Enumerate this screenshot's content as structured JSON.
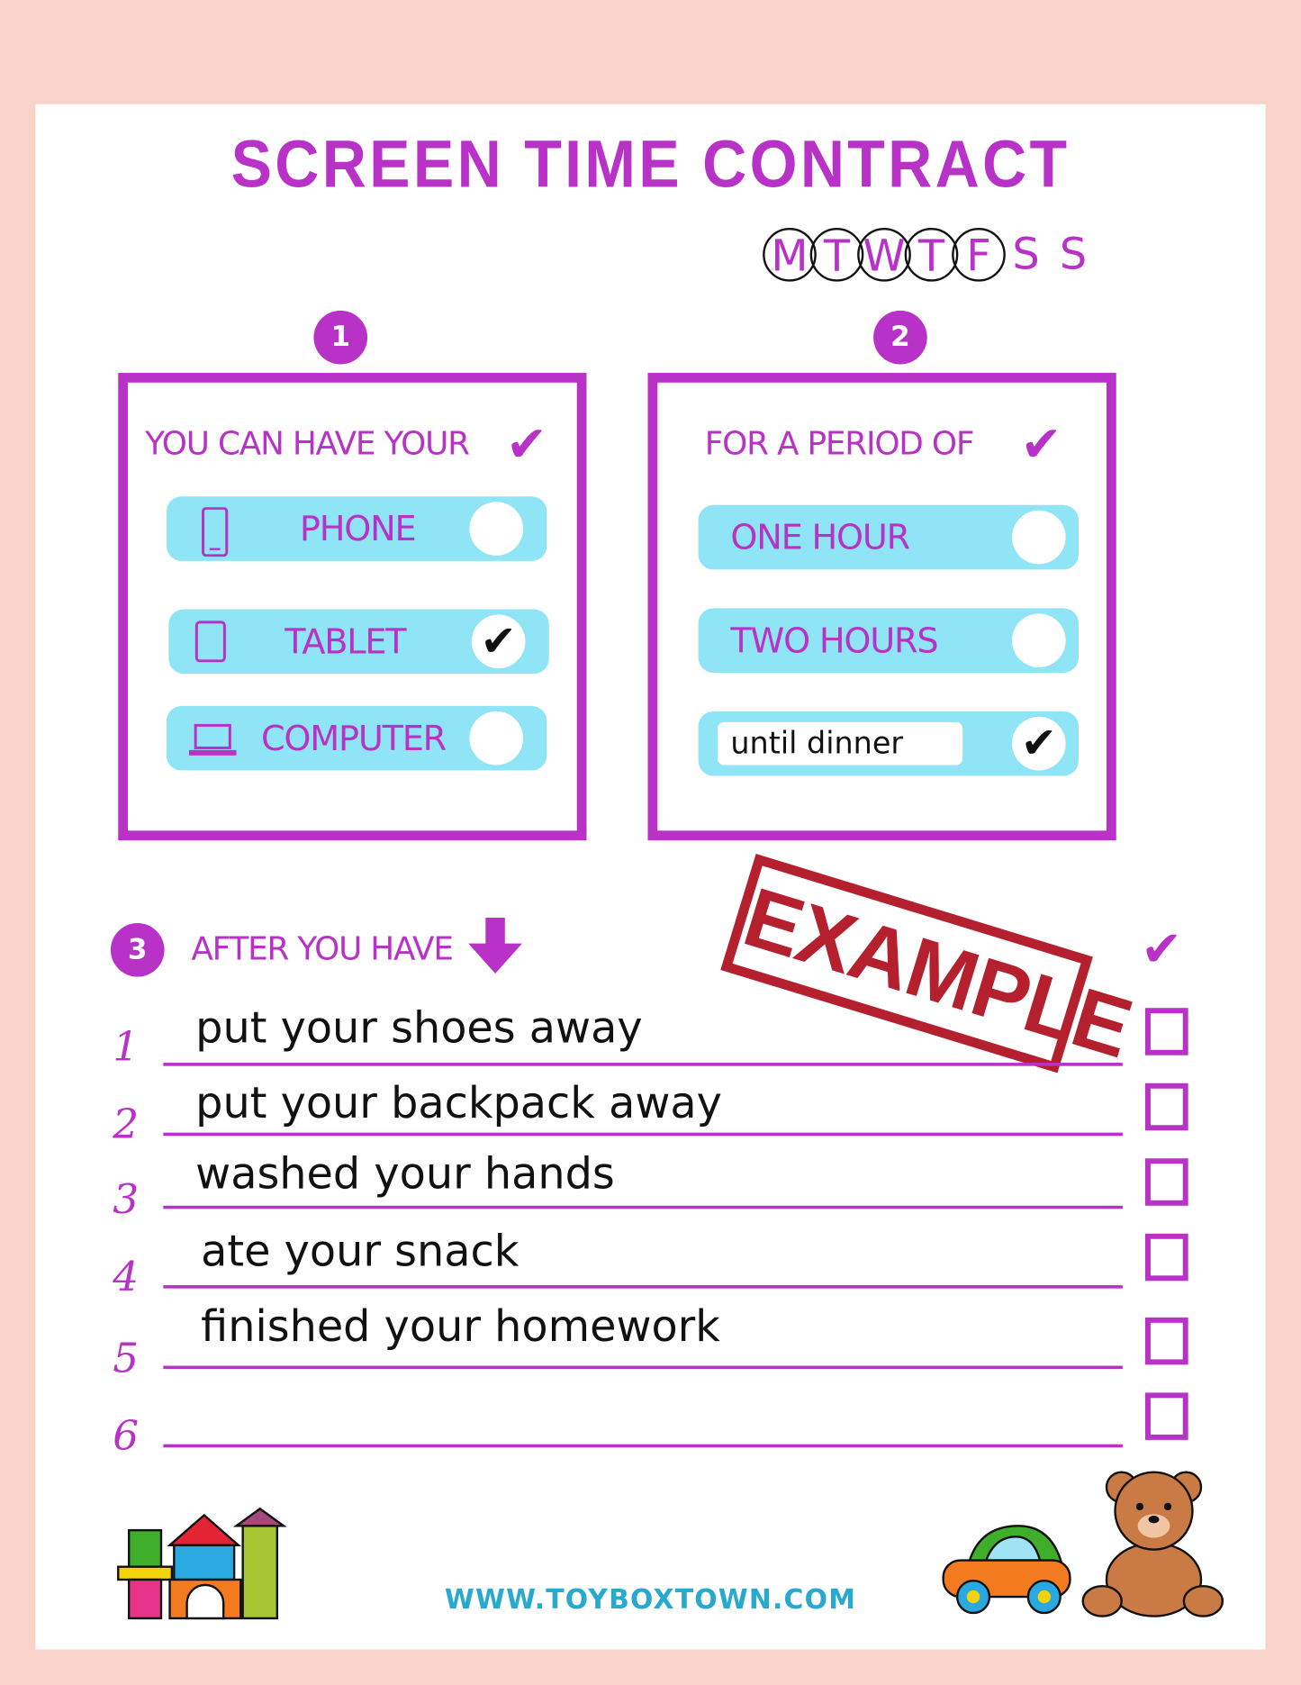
{
  "title": "SCREEN TIME CONTRACT",
  "days": [
    {
      "label": "M",
      "circled": true
    },
    {
      "label": "T",
      "circled": true
    },
    {
      "label": "W",
      "circled": true
    },
    {
      "label": "T",
      "circled": true
    },
    {
      "label": "F",
      "circled": true
    },
    {
      "label": "S",
      "circled": false
    },
    {
      "label": "S",
      "circled": false
    }
  ],
  "section1": {
    "number": "1",
    "heading": "YOU CAN HAVE YOUR",
    "options": [
      {
        "label": "PHONE",
        "icon": "phone-icon",
        "checked": false
      },
      {
        "label": "TABLET",
        "icon": "tablet-icon",
        "checked": true
      },
      {
        "label": "COMPUTER",
        "icon": "laptop-icon",
        "checked": false
      }
    ]
  },
  "section2": {
    "number": "2",
    "heading": "FOR A PERIOD OF",
    "options": [
      {
        "label": "ONE HOUR",
        "checked": false
      },
      {
        "label": "TWO HOURS",
        "checked": false
      }
    ],
    "custom": {
      "value": "until dinner",
      "checked": true
    }
  },
  "section3": {
    "number": "3",
    "heading": "AFTER YOU HAVE",
    "tasks": [
      {
        "n": "1",
        "text": "put your shoes away"
      },
      {
        "n": "2",
        "text": "put your backpack away"
      },
      {
        "n": "3",
        "text": "washed your hands"
      },
      {
        "n": "4",
        "text": "ate your snack"
      },
      {
        "n": "5",
        "text": "finished your homework"
      },
      {
        "n": "6",
        "text": ""
      }
    ]
  },
  "stamp": "EXAMPLE",
  "website": "WWW.TOYBOXTOWN.COM",
  "colors": {
    "accent": "#b832c8",
    "pill": "#8fe5f5",
    "background": "#f8d3c9",
    "stamp": "#b5202e",
    "link": "#27a9d0"
  }
}
